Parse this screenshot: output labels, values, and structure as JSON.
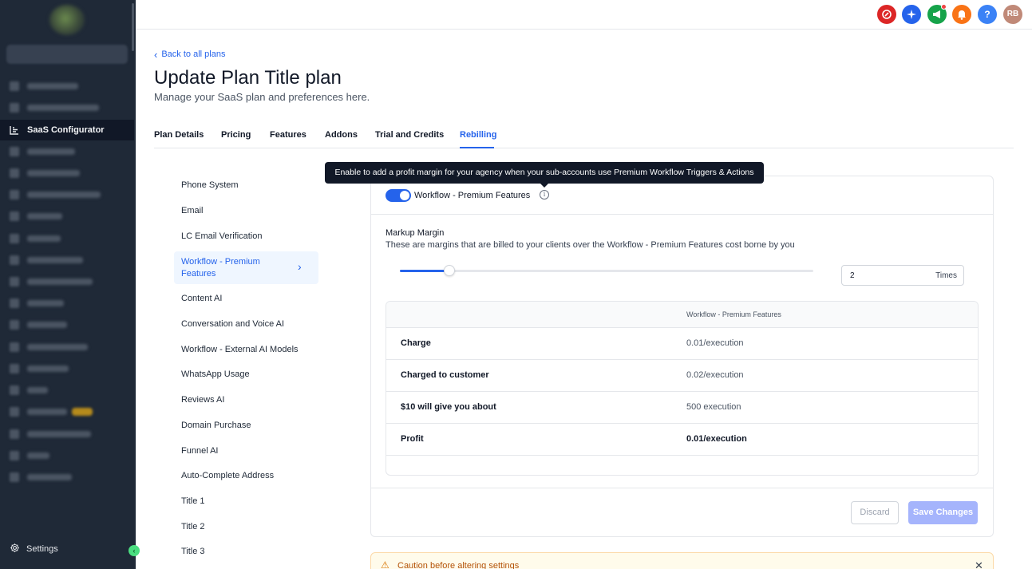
{
  "sidebar": {
    "active_item": {
      "icon": "bar-chart-icon",
      "label": "SaaS Configurator"
    },
    "settings_label": "Settings"
  },
  "topbar": {
    "avatar_initials": "RB",
    "help_label": "?"
  },
  "header": {
    "back_link": "Back to all plans",
    "title": "Update Plan Title plan",
    "subtitle": "Manage your SaaS plan and preferences here."
  },
  "tabs": [
    {
      "label": "Plan Details"
    },
    {
      "label": "Pricing"
    },
    {
      "label": "Features"
    },
    {
      "label": "Addons"
    },
    {
      "label": "Trial and Credits"
    },
    {
      "label": "Rebilling",
      "active": true
    }
  ],
  "features": [
    "Phone System",
    "Email",
    "LC Email Verification",
    "Workflow - Premium Features",
    "Content AI",
    "Conversation and Voice AI",
    "Workflow - External AI Models",
    "WhatsApp Usage",
    "Reviews AI",
    "Domain Purchase",
    "Funnel AI",
    "Auto-Complete Address",
    "Title 1",
    "Title 2",
    "Title 3"
  ],
  "selected_feature": "Workflow - Premium Features",
  "tooltip": "Enable to add a profit margin for your agency when your sub-accounts use Premium Workflow Triggers & Actions",
  "card": {
    "toggle_label": "Workflow - Premium Features",
    "toggle_on": true,
    "markup_label": "Markup Margin",
    "markup_desc": "These are margins that are billed to your clients over the Workflow - Premium Features cost borne by you",
    "slider_fraction": 0.12,
    "times_value": "2",
    "times_suffix": "Times",
    "table": {
      "column_header": "Workflow - Premium Features",
      "rows": [
        {
          "key": "Charge",
          "value": "0.01/execution"
        },
        {
          "key": "Charged to customer",
          "value": "0.02/execution"
        },
        {
          "key": "$10 will give you about",
          "value": "500 execution"
        },
        {
          "key": "Profit",
          "value": "0.01/execution"
        }
      ]
    },
    "discard_label": "Discard",
    "save_label": "Save Changes"
  },
  "caution": {
    "text": "Caution before altering settings"
  },
  "colors": {
    "accent": "#2563eb",
    "sidebar_bg": "#1f2937",
    "save_disabled": "#a5b4fc"
  }
}
